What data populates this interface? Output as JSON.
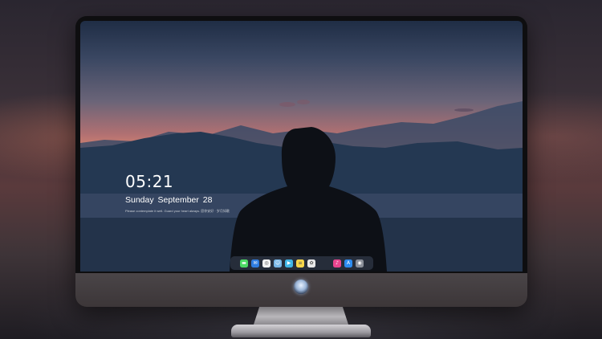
{
  "lock_screen": {
    "time": "05:21",
    "date": "Sunday September  28",
    "quote": "Please contemplate it well. Guard your heart always. 愿你安好 · 岁月如歌"
  },
  "dock": {
    "apps": [
      {
        "name": "messages",
        "color": "#4cd964",
        "glyph": "▬"
      },
      {
        "name": "mail",
        "color": "#2f7de1",
        "glyph": "✉"
      },
      {
        "name": "safari",
        "color": "#f2f2f2",
        "glyph": "◎"
      },
      {
        "name": "finder",
        "color": "#7ab8e8",
        "glyph": "☺"
      },
      {
        "name": "clapper",
        "color": "#3fb6e8",
        "glyph": "▶"
      },
      {
        "name": "notes",
        "color": "#f7d64a",
        "glyph": "≡"
      },
      {
        "name": "photos",
        "color": "#e8e8e8",
        "glyph": "✿"
      },
      {
        "name": "music",
        "color": "#e9458f",
        "glyph": "♪"
      },
      {
        "name": "app-store",
        "color": "#2d8cf0",
        "glyph": "A"
      },
      {
        "name": "camera",
        "color": "#8a8f99",
        "glyph": "◉"
      }
    ]
  },
  "colors": {
    "monitor_bezel": "#0e0e10",
    "monitor_chin": "#4a4548",
    "sky_top": "#1f2d45",
    "horizon_glow": "#d88570"
  }
}
